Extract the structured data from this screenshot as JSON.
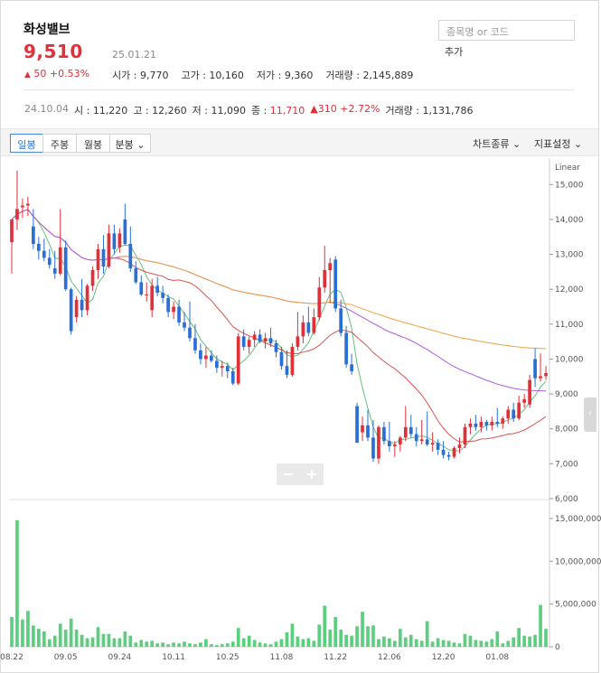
{
  "stock": {
    "name": "화성밸브",
    "price": "9,510",
    "date": "25.01.21",
    "change_amount": "50",
    "change_pct": "+0.53%",
    "stats": [
      {
        "label": "시가",
        "value": "9,770"
      },
      {
        "label": "고가",
        "value": "10,160"
      },
      {
        "label": "저가",
        "value": "9,360"
      },
      {
        "label": "거래량",
        "value": "2,145,889"
      }
    ]
  },
  "search": {
    "placeholder": "종목명 or 코드",
    "add_label": "추가"
  },
  "reference": {
    "date": "24.10.04",
    "open_label": "시",
    "open": "11,220",
    "high_label": "고",
    "high": "12,260",
    "low_label": "저",
    "low": "11,090",
    "close_label": "종",
    "close": "11,710",
    "change": "310",
    "change_pct": "+2.72%",
    "volume_label": "거래량",
    "volume": "1,131,786"
  },
  "toolbar": {
    "tabs": [
      "일봉",
      "주봉",
      "월봉",
      "분봉"
    ],
    "active_tab": "일봉",
    "chart_type": "차트종류",
    "indicator": "지표설정"
  },
  "colors": {
    "up": "#e0303a",
    "down": "#2a6fd6",
    "volume": "#5ccf7e",
    "ma5": "#66c07a",
    "ma20": "#d9534f",
    "ma60": "#b25be0",
    "ma120": "#f0a040"
  },
  "chart_data": {
    "type": "candlestick",
    "scale_label": "Linear",
    "price_ylim": [
      6000,
      15500
    ],
    "price_ticks": [
      "15,000",
      "14,000",
      "13,000",
      "12,000",
      "11,000",
      "10,000",
      "9,000",
      "8,000",
      "7,000",
      "6,000"
    ],
    "volume_ticks": [
      "15,000,000",
      "10,000,000",
      "5,000,000",
      "0"
    ],
    "volume_ylim": [
      0,
      17000000
    ],
    "x_labels": [
      {
        "i": 0,
        "label": "08.22"
      },
      {
        "i": 10,
        "label": "09.05"
      },
      {
        "i": 20,
        "label": "09.24"
      },
      {
        "i": 30,
        "label": "10.11"
      },
      {
        "i": 40,
        "label": "10.25"
      },
      {
        "i": 50,
        "label": "11.08"
      },
      {
        "i": 60,
        "label": "11.22"
      },
      {
        "i": 70,
        "label": "12.06"
      },
      {
        "i": 80,
        "label": "12.20"
      },
      {
        "i": 90,
        "label": "01.08"
      }
    ],
    "candles": [
      [
        13350,
        13900,
        12450,
        14000
      ],
      [
        14000,
        15400,
        13700,
        14300
      ],
      [
        14350,
        14600,
        14050,
        14400
      ],
      [
        14400,
        14650,
        14100,
        14450
      ],
      [
        13800,
        14300,
        13150,
        13300
      ],
      [
        13300,
        13500,
        12850,
        13100
      ],
      [
        13100,
        13450,
        12800,
        12900
      ],
      [
        12900,
        13150,
        12600,
        12700
      ],
      [
        12600,
        13100,
        12300,
        12450
      ],
      [
        12450,
        14300,
        12400,
        13200
      ],
      [
        13200,
        13400,
        11950,
        12000
      ],
      [
        12000,
        12050,
        10700,
        10800
      ],
      [
        11200,
        11800,
        11050,
        11700
      ],
      [
        11700,
        12300,
        11200,
        11400
      ],
      [
        11400,
        12150,
        11250,
        12100
      ],
      [
        12100,
        12650,
        11950,
        12550
      ],
      [
        12550,
        13300,
        12300,
        13150
      ],
      [
        13150,
        13550,
        12450,
        12650
      ],
      [
        12650,
        13850,
        12600,
        13600
      ],
      [
        13600,
        13850,
        13000,
        13150
      ],
      [
        13200,
        13750,
        13050,
        13600
      ],
      [
        14000,
        14450,
        13250,
        13300
      ],
      [
        13300,
        13800,
        12500,
        12600
      ],
      [
        12600,
        12800,
        12150,
        12200
      ],
      [
        12200,
        12400,
        11800,
        11850
      ],
      [
        11850,
        12200,
        11650,
        11850
      ],
      [
        11400,
        12300,
        11200,
        12100
      ],
      [
        12100,
        12350,
        11800,
        11900
      ],
      [
        11900,
        12100,
        11600,
        11750
      ],
      [
        11750,
        11850,
        11200,
        11350
      ],
      [
        11350,
        11650,
        11150,
        11500
      ],
      [
        11500,
        11700,
        10950,
        11050
      ],
      [
        11050,
        11350,
        10800,
        10900
      ],
      [
        10900,
        11650,
        10500,
        10600
      ],
      [
        10600,
        11000,
        10150,
        10250
      ],
      [
        10250,
        10450,
        9850,
        10000
      ],
      [
        10000,
        10350,
        9750,
        10100
      ],
      [
        10100,
        10250,
        9900,
        9950
      ],
      [
        9950,
        10100,
        9600,
        9750
      ],
      [
        9750,
        9950,
        9500,
        9800
      ],
      [
        9800,
        9900,
        9450,
        9650
      ],
      [
        9650,
        9750,
        9250,
        9300
      ],
      [
        9300,
        10750,
        9250,
        10650
      ],
      [
        10650,
        10850,
        10250,
        10350
      ],
      [
        10350,
        10650,
        10150,
        10550
      ],
      [
        10550,
        10800,
        10350,
        10700
      ],
      [
        10700,
        10850,
        10450,
        10500
      ],
      [
        10500,
        10750,
        10300,
        10600
      ],
      [
        10600,
        10900,
        10350,
        10450
      ],
      [
        10450,
        10550,
        10050,
        10200
      ],
      [
        10200,
        10350,
        9700,
        9800
      ],
      [
        9800,
        10250,
        9450,
        9550
      ],
      [
        9550,
        10450,
        9500,
        10350
      ],
      [
        10350,
        11350,
        10250,
        10650
      ],
      [
        10650,
        11250,
        10450,
        11050
      ],
      [
        11050,
        11500,
        10650,
        10750
      ],
      [
        10750,
        11450,
        10700,
        11200
      ],
      [
        11200,
        12350,
        11100,
        12050
      ],
      [
        12050,
        13250,
        11900,
        12550
      ],
      [
        12550,
        12900,
        11600,
        12750
      ],
      [
        12850,
        12950,
        11350,
        11450
      ],
      [
        11450,
        11700,
        10650,
        10750
      ],
      [
        10750,
        10950,
        9750,
        9850
      ],
      [
        9850,
        10150,
        9550,
        9650
      ],
      [
        8650,
        8750,
        7650,
        7600
      ],
      [
        7900,
        8350,
        7650,
        8100
      ],
      [
        8100,
        8550,
        7650,
        7750
      ],
      [
        7750,
        8250,
        7050,
        7150
      ],
      [
        7150,
        8100,
        7000,
        8050
      ],
      [
        8050,
        8200,
        7550,
        7650
      ],
      [
        7650,
        8200,
        7350,
        7500
      ],
      [
        7500,
        7650,
        7200,
        7550
      ],
      [
        7550,
        7800,
        7350,
        7750
      ],
      [
        7750,
        8650,
        7650,
        8050
      ],
      [
        8050,
        8400,
        7750,
        7850
      ],
      [
        7850,
        8050,
        7500,
        7650
      ],
      [
        7650,
        8250,
        7550,
        7700
      ],
      [
        7700,
        8500,
        7500,
        7550
      ],
      [
        7550,
        7900,
        7350,
        7600
      ],
      [
        7600,
        7700,
        7250,
        7400
      ],
      [
        7400,
        7650,
        7150,
        7250
      ],
      [
        7250,
        7350,
        7100,
        7200
      ],
      [
        7200,
        7500,
        7150,
        7450
      ],
      [
        7450,
        7750,
        7300,
        7550
      ],
      [
        7550,
        8150,
        7450,
        8050
      ],
      [
        8050,
        8300,
        7850,
        8150
      ],
      [
        8150,
        8400,
        7950,
        8050
      ],
      [
        8050,
        8350,
        7900,
        8200
      ],
      [
        8200,
        8250,
        7950,
        8100
      ],
      [
        8100,
        8350,
        7950,
        8200
      ],
      [
        8200,
        8600,
        8050,
        8150
      ],
      [
        8150,
        8350,
        8000,
        8300
      ],
      [
        8300,
        8650,
        8150,
        8550
      ],
      [
        8550,
        8750,
        8200,
        8300
      ],
      [
        8300,
        8950,
        8250,
        8750
      ],
      [
        8750,
        9000,
        8600,
        8850
      ],
      [
        8700,
        9550,
        8600,
        9400
      ],
      [
        10000,
        10300,
        9200,
        9450
      ],
      [
        9450,
        10160,
        9360,
        9510
      ],
      [
        9510,
        9800,
        9400,
        9600
      ]
    ],
    "volumes": [
      3500000,
      14800000,
      3200000,
      4200000,
      2500000,
      2100000,
      1800000,
      900000,
      1300000,
      2700000,
      2000000,
      3300000,
      2000000,
      1400000,
      1000000,
      1100000,
      2300000,
      1500000,
      1500000,
      1000000,
      1000000,
      1800000,
      1300000,
      500000,
      800000,
      600000,
      700000,
      400000,
      500000,
      300000,
      500000,
      400000,
      600000,
      400000,
      300000,
      500000,
      900000,
      300000,
      200000,
      300000,
      400000,
      600000,
      2200000,
      1000000,
      1300000,
      800000,
      500000,
      400000,
      300000,
      600000,
      900000,
      1700000,
      2700000,
      1200000,
      900000,
      1000000,
      700000,
      2600000,
      4800000,
      2000000,
      3500000,
      2000000,
      1400000,
      1300000,
      2400000,
      4100000,
      2400000,
      2500000,
      900000,
      1200000,
      1000000,
      700000,
      2100000,
      1100000,
      1400000,
      900000,
      700000,
      3000000,
      600000,
      1000000,
      800000,
      700000,
      500000,
      400000,
      1500000,
      1300000,
      800000,
      700000,
      600000,
      900000,
      1800000,
      400000,
      700000,
      1100000,
      2200000,
      1300000,
      1200000,
      1400000,
      4900000,
      2100000
    ]
  }
}
